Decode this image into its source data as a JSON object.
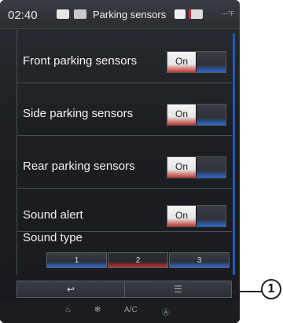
{
  "status_bar": {
    "time": "02:40",
    "title": "Parking sensors",
    "temperature": "---°F"
  },
  "settings": [
    {
      "label": "Front parking sensors",
      "state": "On"
    },
    {
      "label": "Side parking sensors",
      "state": "On"
    },
    {
      "label": "Rear parking sensors",
      "state": "On"
    },
    {
      "label": "Sound alert",
      "state": "On"
    }
  ],
  "sound_type": {
    "label": "Sound type",
    "options": [
      "1",
      "2",
      "3"
    ],
    "selected": "2"
  },
  "bottom_bar": {
    "back": "↩",
    "menu": "☰"
  },
  "climate": {
    "ac": "A/C",
    "defrost": "Ⓐ"
  },
  "callout": "1",
  "colors": {
    "accent_blue": "#2b6ad0",
    "accent_red": "#c0362c"
  }
}
